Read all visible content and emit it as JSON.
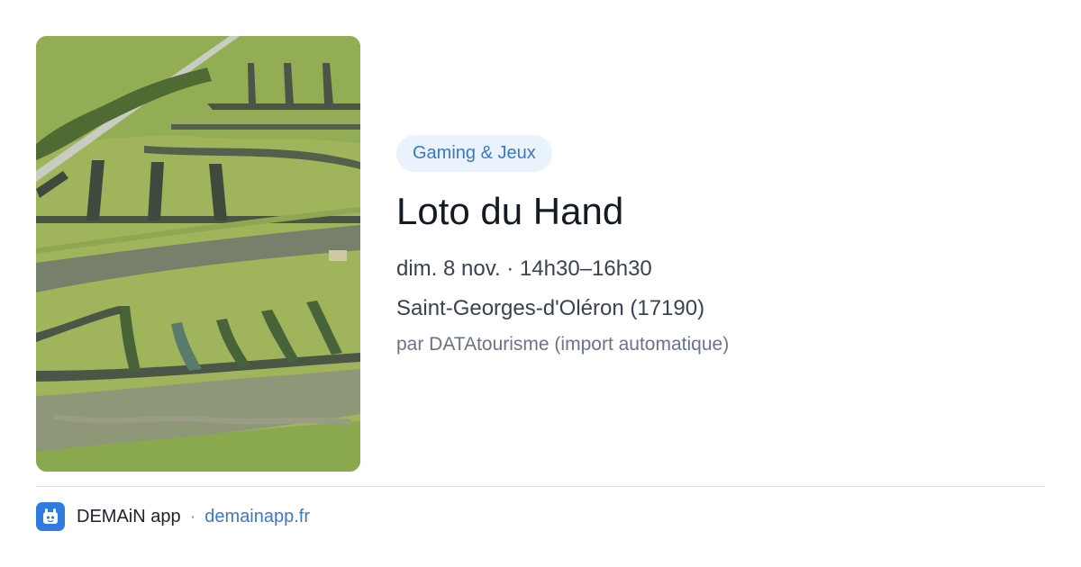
{
  "event": {
    "category": "Gaming & Jeux",
    "title": "Loto du Hand",
    "datetime": "dim. 8 nov. · 14h30–16h30",
    "location": "Saint-Georges-d'Oléron (17190)",
    "source": "par DATAtourisme (import automatique)"
  },
  "footer": {
    "app_name": "DEMAiN app",
    "separator": "·",
    "domain": "demainapp.fr"
  },
  "colors": {
    "accent": "#3a78c8",
    "badge_bg": "#eaf2fd",
    "title": "#141a24",
    "body": "#3a4252",
    "muted": "#6a7487",
    "logo_bg": "#2f7be0"
  },
  "icons": {
    "logo": "demain-app-logo-icon"
  }
}
